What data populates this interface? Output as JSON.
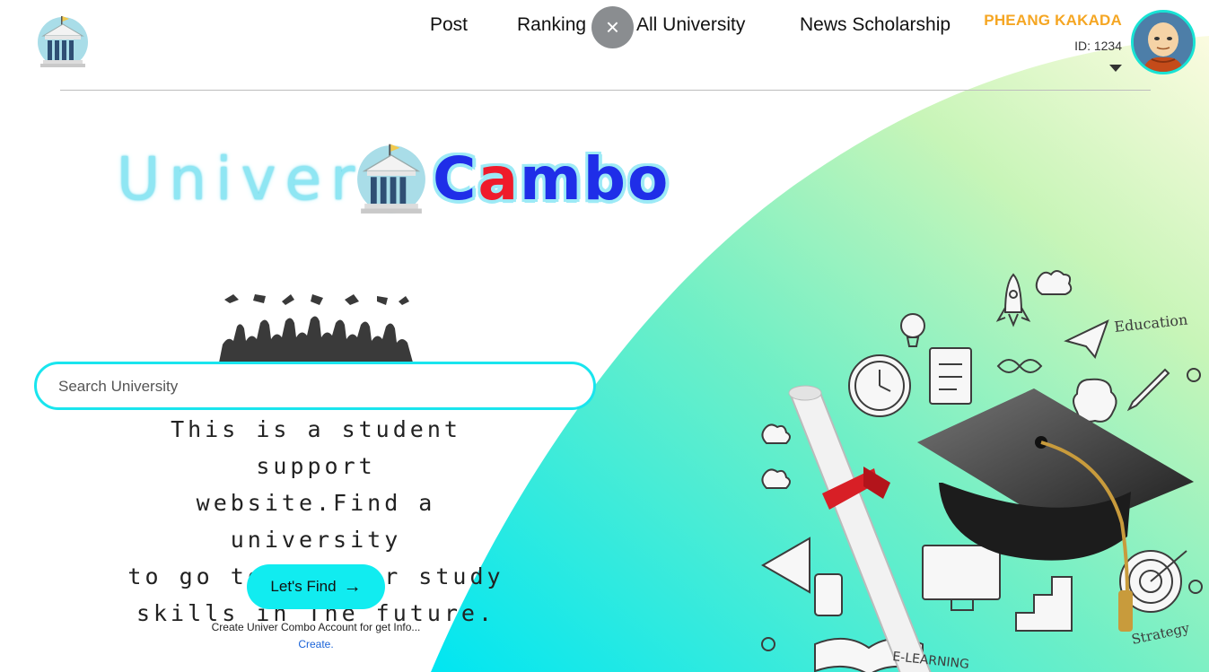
{
  "nav": {
    "items": [
      "Post",
      "Ranking",
      "All University",
      "News Scholarship"
    ],
    "close_icon": "×"
  },
  "user": {
    "name": "PHEANG KAKADA",
    "id": "ID: 1234"
  },
  "brand": {
    "part1": "Univer",
    "part2_letters": [
      "C",
      "a",
      "m",
      "b",
      "o"
    ],
    "colors": {
      "cyan": "#8fe6f3",
      "blue": "#1f2ee8",
      "red": "#ef1b2b",
      "accent": "#11ecf0"
    }
  },
  "search": {
    "placeholder": "Search University",
    "value": ""
  },
  "tagline": {
    "lines": [
      "This is a student support",
      "website.Find a university",
      "to go to On your study",
      "skills in The future."
    ]
  },
  "cta": {
    "label": "Let's Find",
    "arrow": "→"
  },
  "footer": {
    "text": "Create Univer Combo Account for get Info...",
    "link": "Create."
  },
  "illustration": {
    "labels": [
      "Education",
      "E-LEARNING",
      "Strategy"
    ]
  }
}
